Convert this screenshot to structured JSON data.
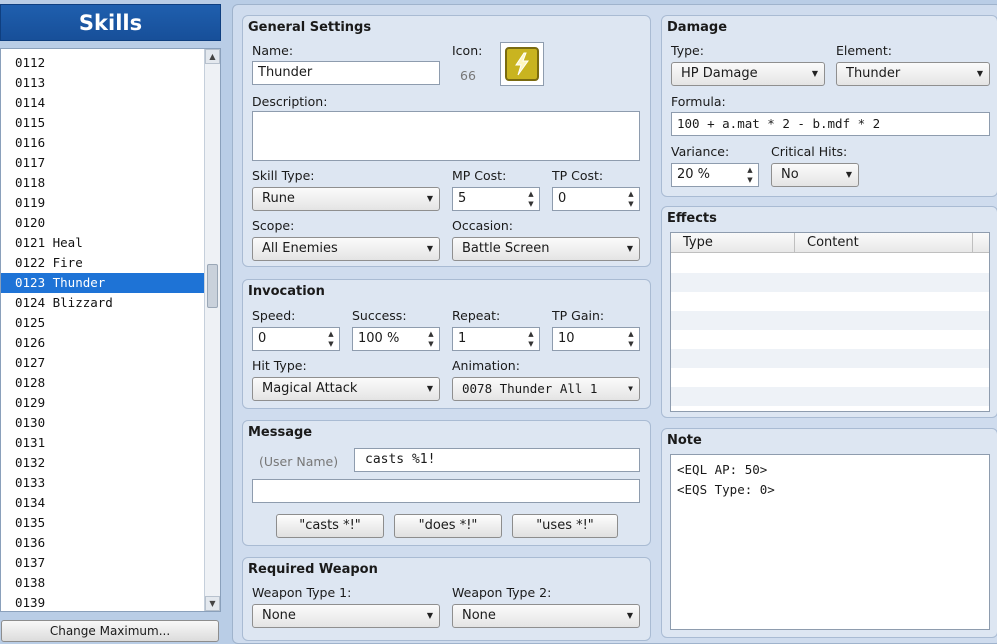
{
  "sidebar": {
    "title": "Skills",
    "items": [
      {
        "text": "0112",
        "selected": false
      },
      {
        "text": "0113",
        "selected": false
      },
      {
        "text": "0114",
        "selected": false
      },
      {
        "text": "0115",
        "selected": false
      },
      {
        "text": "0116",
        "selected": false
      },
      {
        "text": "0117",
        "selected": false
      },
      {
        "text": "0118",
        "selected": false
      },
      {
        "text": "0119",
        "selected": false
      },
      {
        "text": "0120",
        "selected": false
      },
      {
        "text": "0121 Heal",
        "selected": false
      },
      {
        "text": "0122 Fire",
        "selected": false
      },
      {
        "text": "0123 Thunder",
        "selected": true
      },
      {
        "text": "0124 Blizzard",
        "selected": false
      },
      {
        "text": "0125",
        "selected": false
      },
      {
        "text": "0126",
        "selected": false
      },
      {
        "text": "0127",
        "selected": false
      },
      {
        "text": "0128",
        "selected": false
      },
      {
        "text": "0129",
        "selected": false
      },
      {
        "text": "0130",
        "selected": false
      },
      {
        "text": "0131",
        "selected": false
      },
      {
        "text": "0132",
        "selected": false
      },
      {
        "text": "0133",
        "selected": false
      },
      {
        "text": "0134",
        "selected": false
      },
      {
        "text": "0135",
        "selected": false
      },
      {
        "text": "0136",
        "selected": false
      },
      {
        "text": "0137",
        "selected": false
      },
      {
        "text": "0138",
        "selected": false
      },
      {
        "text": "0139",
        "selected": false
      }
    ],
    "change_maximum_label": "Change Maximum..."
  },
  "general": {
    "title": "General Settings",
    "name_label": "Name:",
    "name_value": "Thunder",
    "icon_label": "Icon:",
    "icon_index": "66",
    "icon_name": "lightning-icon",
    "description_label": "Description:",
    "description_value": "",
    "skill_type_label": "Skill Type:",
    "skill_type_value": "Rune",
    "mp_cost_label": "MP Cost:",
    "mp_cost_value": "5",
    "tp_cost_label": "TP Cost:",
    "tp_cost_value": "0",
    "scope_label": "Scope:",
    "scope_value": "All Enemies",
    "occasion_label": "Occasion:",
    "occasion_value": "Battle Screen"
  },
  "invocation": {
    "title": "Invocation",
    "speed_label": "Speed:",
    "speed_value": "0",
    "success_label": "Success:",
    "success_value": "100 %",
    "repeat_label": "Repeat:",
    "repeat_value": "1",
    "tp_gain_label": "TP Gain:",
    "tp_gain_value": "10",
    "hit_type_label": "Hit Type:",
    "hit_type_value": "Magical Attack",
    "animation_label": "Animation:",
    "animation_value": "0078 Thunder All 1"
  },
  "message": {
    "title": "Message",
    "user_name_placeholder": "(User Name)",
    "line1_value": "casts %1!",
    "line2_value": "",
    "btn_casts": "\"casts *!\"",
    "btn_does": "\"does *!\"",
    "btn_uses": "\"uses *!\""
  },
  "required_weapon": {
    "title": "Required Weapon",
    "type1_label": "Weapon Type 1:",
    "type1_value": "None",
    "type2_label": "Weapon Type 2:",
    "type2_value": "None"
  },
  "damage": {
    "title": "Damage",
    "type_label": "Type:",
    "type_value": "HP Damage",
    "element_label": "Element:",
    "element_value": "Thunder",
    "formula_label": "Formula:",
    "formula_value": "100 + a.mat * 2 - b.mdf * 2",
    "variance_label": "Variance:",
    "variance_value": "20 %",
    "critical_label": "Critical Hits:",
    "critical_value": "No"
  },
  "effects": {
    "title": "Effects",
    "col_type": "Type",
    "col_content": "Content"
  },
  "note": {
    "title": "Note",
    "text": "<EQL AP: 50>\n<EQS Type: 0>"
  },
  "colors": {
    "accent": "#1e73d6",
    "header": "#1f5fae",
    "icon_gold": "#c9b420"
  }
}
